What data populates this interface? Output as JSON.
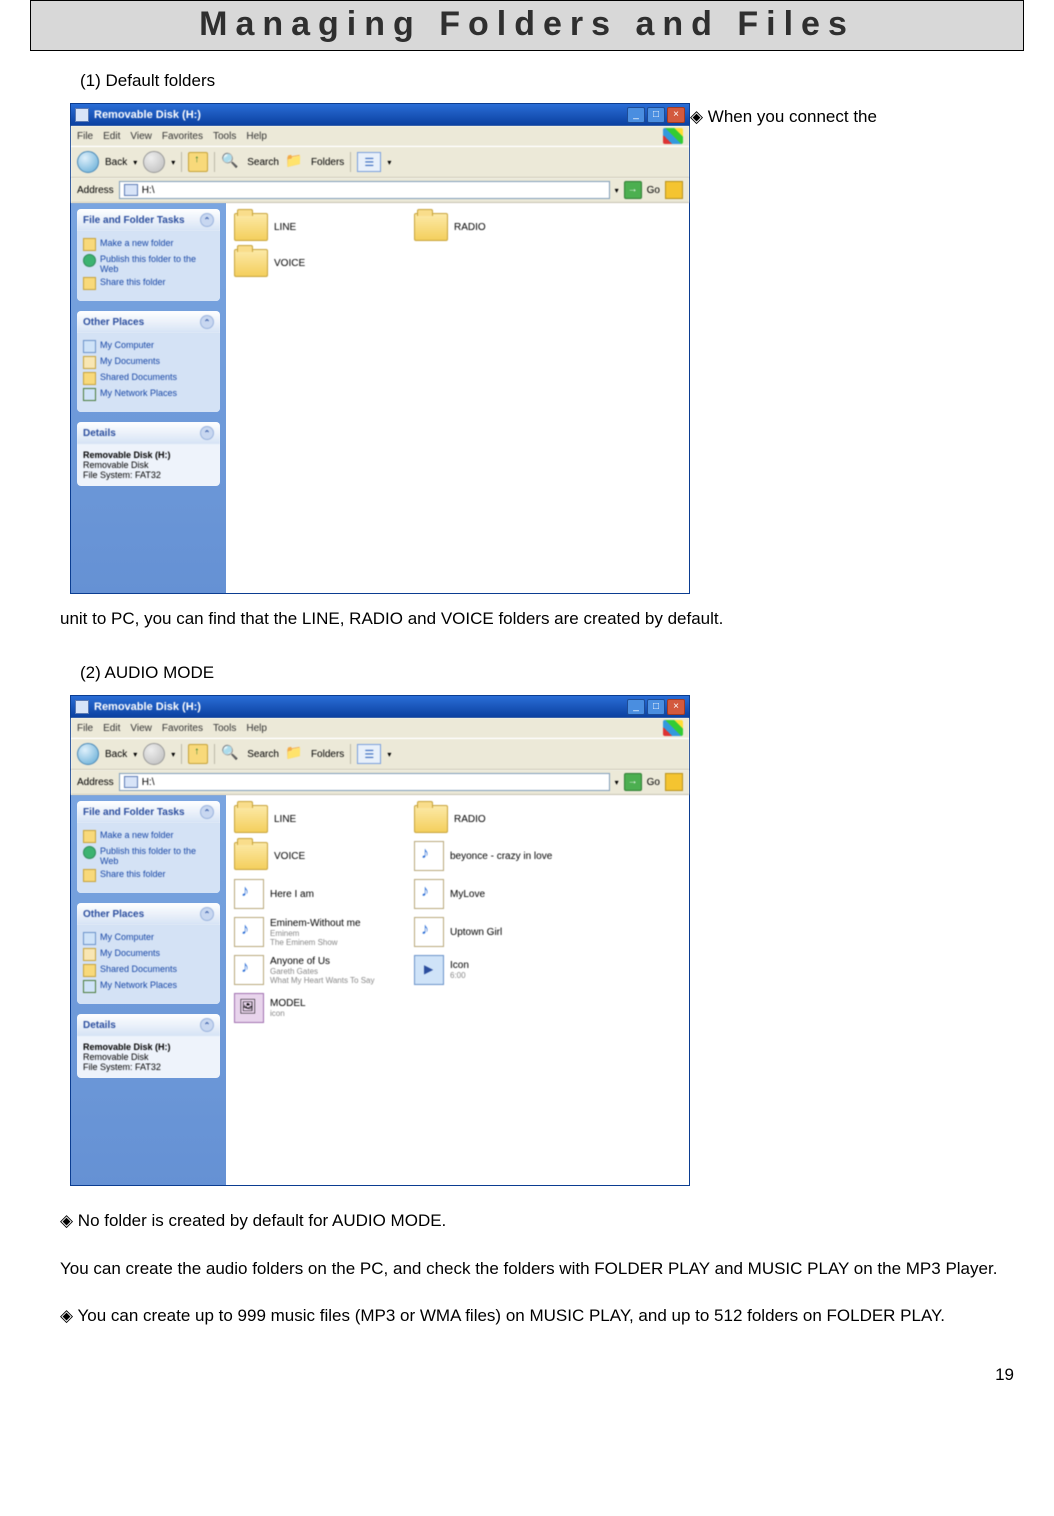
{
  "doc": {
    "page_title": "Managing Folders and Files",
    "section1_heading": "(1) Default folders",
    "para1_inline": "◈ When you connect the",
    "para1_cont": "unit to PC, you can find that the LINE, RADIO and VOICE folders are created by default.",
    "section2_heading": "(2)  AUDIO MODE",
    "para2_a": "◈ No folder is created by default for AUDIO MODE.",
    "para2_b": "You can create the audio folders on the PC, and check the folders with FOLDER PLAY and MUSIC PLAY on the MP3 Player.",
    "para2_c": "◈ You can create up to 999 music files (MP3 or WMA files) on MUSIC PLAY, and up to 512 folders on FOLDER PLAY.",
    "page_number": "19"
  },
  "xp": {
    "title": "Removable Disk (H:)",
    "menu": {
      "file": "File",
      "edit": "Edit",
      "view": "View",
      "favorites": "Favorites",
      "tools": "Tools",
      "help": "Help"
    },
    "toolbar": {
      "back": "Back",
      "search": "Search",
      "folders": "Folders"
    },
    "address_label": "Address",
    "address_value": "H:\\",
    "go_label": "Go",
    "panels": {
      "tasks_header": "File and Folder Tasks",
      "tasks": {
        "new_folder": "Make a new folder",
        "publish": "Publish this folder to the Web",
        "share": "Share this folder"
      },
      "places_header": "Other Places",
      "places": {
        "my_computer": "My Computer",
        "my_documents": "My Documents",
        "shared_documents": "Shared Documents",
        "my_network": "My Network Places"
      },
      "details_header": "Details",
      "details": {
        "name": "Removable Disk (H:)",
        "type": "Removable Disk",
        "fs": "File System: FAT32"
      }
    }
  },
  "content1": {
    "line": "LINE",
    "radio": "RADIO",
    "voice": "VOICE"
  },
  "content2": {
    "line": "LINE",
    "radio": "RADIO",
    "voice": "VOICE",
    "beyonce": "beyonce - crazy in love",
    "here_i_am": "Here I am",
    "mylove": "MyLove",
    "eminem_title": "Eminem-Without me",
    "eminem_sub1": "Eminem",
    "eminem_sub2": "The Eminem Show",
    "uptown": "Uptown Girl",
    "anyone_title": "Anyone of Us",
    "anyone_sub1": "Gareth Gates",
    "anyone_sub2": "What My Heart Wants To Say",
    "icon_title": "Icon",
    "icon_sub": "6:00",
    "model_title": "MODEL",
    "model_sub": "icon"
  }
}
